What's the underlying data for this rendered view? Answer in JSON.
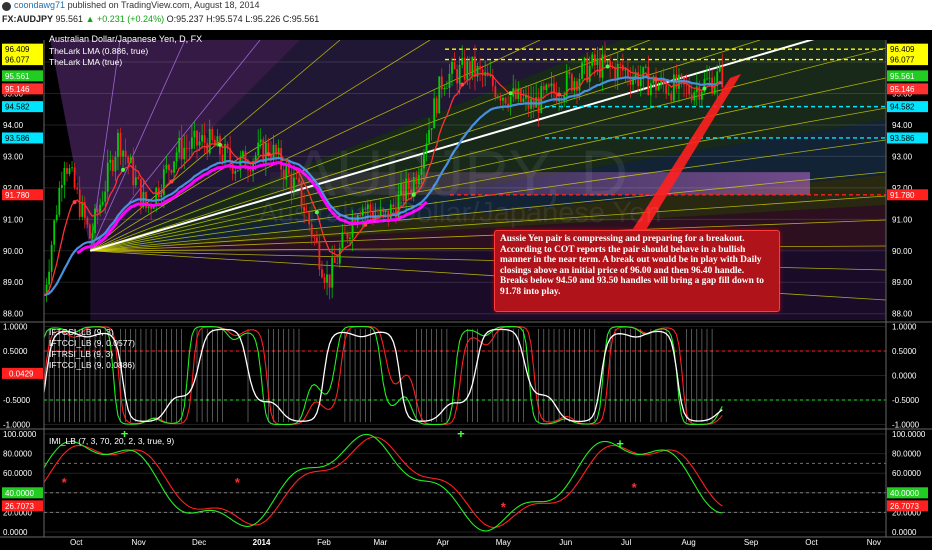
{
  "header": {
    "author": "coondawg71",
    "published": "published on TradingView.com, August 18, 2014",
    "symbol": "FX:AUDJPY",
    "price": "95.561",
    "change": "+0.231 (+0.24%)",
    "open": "O:95.237",
    "high": "H:95.574",
    "low": "L:95.226",
    "close": "C:95.561"
  },
  "annotation": "Aussie Yen pair is compressing and preparing for a breakout.  According to COT reports the pair should behave in a bullish manner in the near term. A break out would be in play with Daily closings above an initial price of 96.00 and then 96.40 handle. Breaks below 94.50 and 93.50 handles will bring a gap fill down to 91.78 into play.",
  "colors": {
    "background": "#000000",
    "up_candle": "#00d000",
    "down_candle": "#ff2020",
    "lma_fast": "#ff3030",
    "lma_slow": "#4a90e0",
    "fan_line": "#e0e000",
    "trendline": "#ffffff",
    "magenta_band": "#ff00ff",
    "annotation_box": "#b0131a"
  },
  "chart_data": [
    {
      "type": "candlestick",
      "title": "Australian Dollar/Japanese Yen, D, FX",
      "watermark_symbol": "AUDJPY, D",
      "watermark_name": "Australian Dollar/Japanese Yen",
      "legend": [
        "TheLark LMA (0.886, true)",
        "TheLark LMA (true)"
      ],
      "y_ticks": [
        88.0,
        89.0,
        90.0,
        91.0,
        92.0,
        93.0,
        94.0,
        95.0,
        96.0
      ],
      "ylim": [
        87.8,
        96.7
      ],
      "x_ticks": [
        "Oct",
        "Nov",
        "Dec",
        "2014",
        "Feb",
        "Mar",
        "Apr",
        "May",
        "Jun",
        "Jul",
        "Aug",
        "Sep",
        "Oct",
        "Nov"
      ],
      "price_labels": [
        {
          "text": "96.409",
          "value": 96.409,
          "color": "#ffff00",
          "line": "dashed"
        },
        {
          "text": "96.077",
          "value": 96.077,
          "color": "#ffff00",
          "line": "dashed"
        },
        {
          "text": "95.561",
          "value": 95.561,
          "color": "#22cc22",
          "line": "none"
        },
        {
          "text": "95.146",
          "value": 95.146,
          "color": "#ff3030",
          "line": "none"
        },
        {
          "text": "94.582",
          "value": 94.582,
          "color": "#00e5ff",
          "line": "dashed"
        },
        {
          "text": "93.586",
          "value": 93.586,
          "color": "#00e5ff",
          "line": "dashed"
        },
        {
          "text": "91.780",
          "value": 91.78,
          "color": "#ff2020",
          "line": "dashed"
        }
      ],
      "closes_approx": [
        {
          "date": "2013-09-15",
          "value": 88.6
        },
        {
          "date": "2013-09-25",
          "value": 93.0
        },
        {
          "date": "2013-10-08",
          "value": 90.4
        },
        {
          "date": "2013-10-22",
          "value": 93.6
        },
        {
          "date": "2013-11-05",
          "value": 91.3
        },
        {
          "date": "2013-11-20",
          "value": 93.2
        },
        {
          "date": "2013-12-05",
          "value": 93.5
        },
        {
          "date": "2013-12-20",
          "value": 92.7
        },
        {
          "date": "2014-01-05",
          "value": 93.3
        },
        {
          "date": "2014-01-20",
          "value": 91.8
        },
        {
          "date": "2014-02-03",
          "value": 89.0
        },
        {
          "date": "2014-02-18",
          "value": 91.5
        },
        {
          "date": "2014-03-03",
          "value": 91.0
        },
        {
          "date": "2014-03-18",
          "value": 92.3
        },
        {
          "date": "2014-04-01",
          "value": 95.5
        },
        {
          "date": "2014-04-15",
          "value": 95.8
        },
        {
          "date": "2014-05-01",
          "value": 95.0
        },
        {
          "date": "2014-05-15",
          "value": 94.6
        },
        {
          "date": "2014-06-01",
          "value": 95.3
        },
        {
          "date": "2014-06-15",
          "value": 95.9
        },
        {
          "date": "2014-07-01",
          "value": 95.7
        },
        {
          "date": "2014-07-15",
          "value": 95.3
        },
        {
          "date": "2014-08-01",
          "value": 95.1
        },
        {
          "date": "2014-08-18",
          "value": 95.561
        }
      ]
    },
    {
      "type": "line",
      "legend": [
        "IFTCCI_LB (9, 3)",
        "IFTCCI_LB (9, 0.0577)",
        "IFTRSI_LB (9, 3)",
        "IFTCCI_LB (9, 0.0886)"
      ],
      "y_ticks": [
        1.0,
        0.5,
        0.0,
        -0.5,
        -1.0
      ],
      "y_tick_labels": [
        "1.0000",
        "0.5000",
        "0.0000",
        "-0.5000",
        "-1.0000"
      ],
      "ylim": [
        -1.05,
        1.05
      ],
      "current_value": "0.0429",
      "levels": [
        0.5,
        -0.5
      ]
    },
    {
      "type": "line",
      "legend": [
        "IMI_LB (7, 3, 70, 20, 2, 3, true, 9)"
      ],
      "y_ticks": [
        100,
        80,
        60,
        40,
        20,
        0
      ],
      "y_tick_labels": [
        "100.0000",
        "80.0000",
        "60.0000",
        "40.0000",
        "20.0000",
        "0.0000"
      ],
      "ylim": [
        -3,
        103
      ],
      "current_value_green": "40.0000",
      "current_value_red": "26.7073",
      "levels": [
        70,
        40,
        20
      ]
    }
  ]
}
